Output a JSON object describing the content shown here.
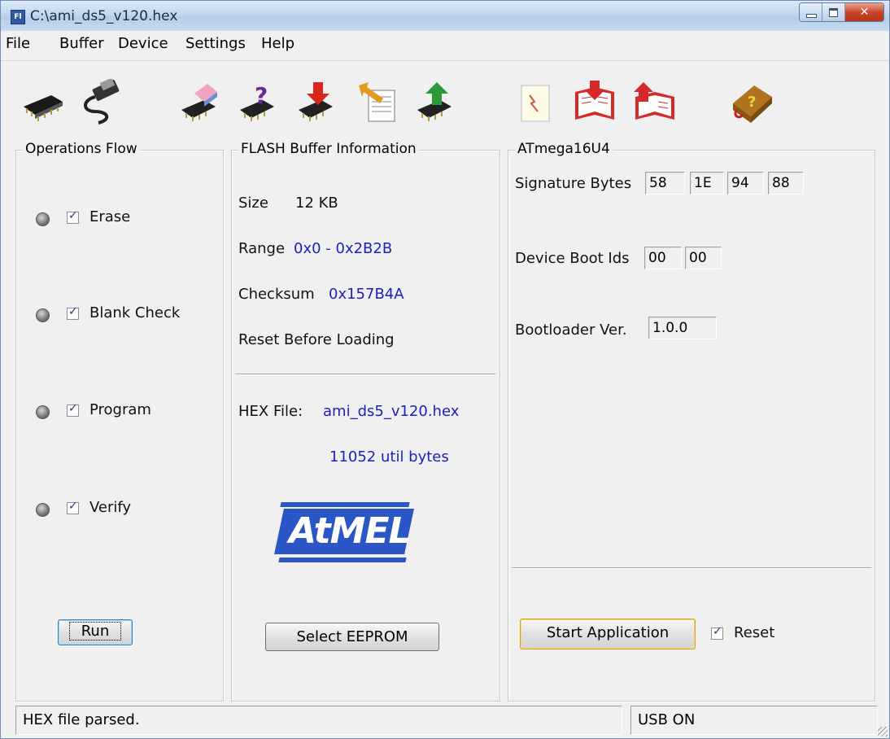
{
  "window": {
    "title": "C:\\ami_ds5_v120.hex",
    "app_icon_text": "Fl"
  },
  "menu": [
    "File",
    "Buffer",
    "Device",
    "Settings",
    "Help"
  ],
  "toolbar_icons": [
    "chip-icon",
    "usb-cable-icon",
    "erase-chip-icon",
    "blank-check-chip-icon",
    "program-chip-icon",
    "read-chip-icon",
    "verify-chip-icon",
    "document-icon",
    "load-book-icon",
    "save-book-icon",
    "help-book-icon"
  ],
  "ops": {
    "legend": "Operations Flow",
    "items": [
      {
        "label": "Erase",
        "checked": true
      },
      {
        "label": "Blank Check",
        "checked": true
      },
      {
        "label": "Program",
        "checked": true
      },
      {
        "label": "Verify",
        "checked": true
      }
    ],
    "run_label": "Run"
  },
  "flash": {
    "legend": "FLASH Buffer Information",
    "size_label": "Size",
    "size_value": "12 KB",
    "range_label": "Range",
    "range_value": "0x0 - 0x2B2B",
    "checksum_label": "Checksum",
    "checksum_value": "0x157B4A",
    "reset_label": "Reset Before Loading",
    "hex_label": "HEX File:",
    "hex_value": "ami_ds5_v120.hex",
    "bytes_value": "11052 util bytes",
    "logo_text": "AtMEL",
    "eeprom_label": "Select EEPROM"
  },
  "device": {
    "legend": "ATmega16U4",
    "sig_label": "Signature Bytes",
    "sig": [
      "58",
      "1E",
      "94",
      "88"
    ],
    "boot_label": "Device Boot Ids",
    "boot": [
      "00",
      "00"
    ],
    "ver_label": "Bootloader Ver.",
    "ver_value": "1.0.0",
    "start_label": "Start Application",
    "reset_label": "Reset"
  },
  "status": {
    "left": "HEX file parsed.",
    "right": "USB ON"
  }
}
